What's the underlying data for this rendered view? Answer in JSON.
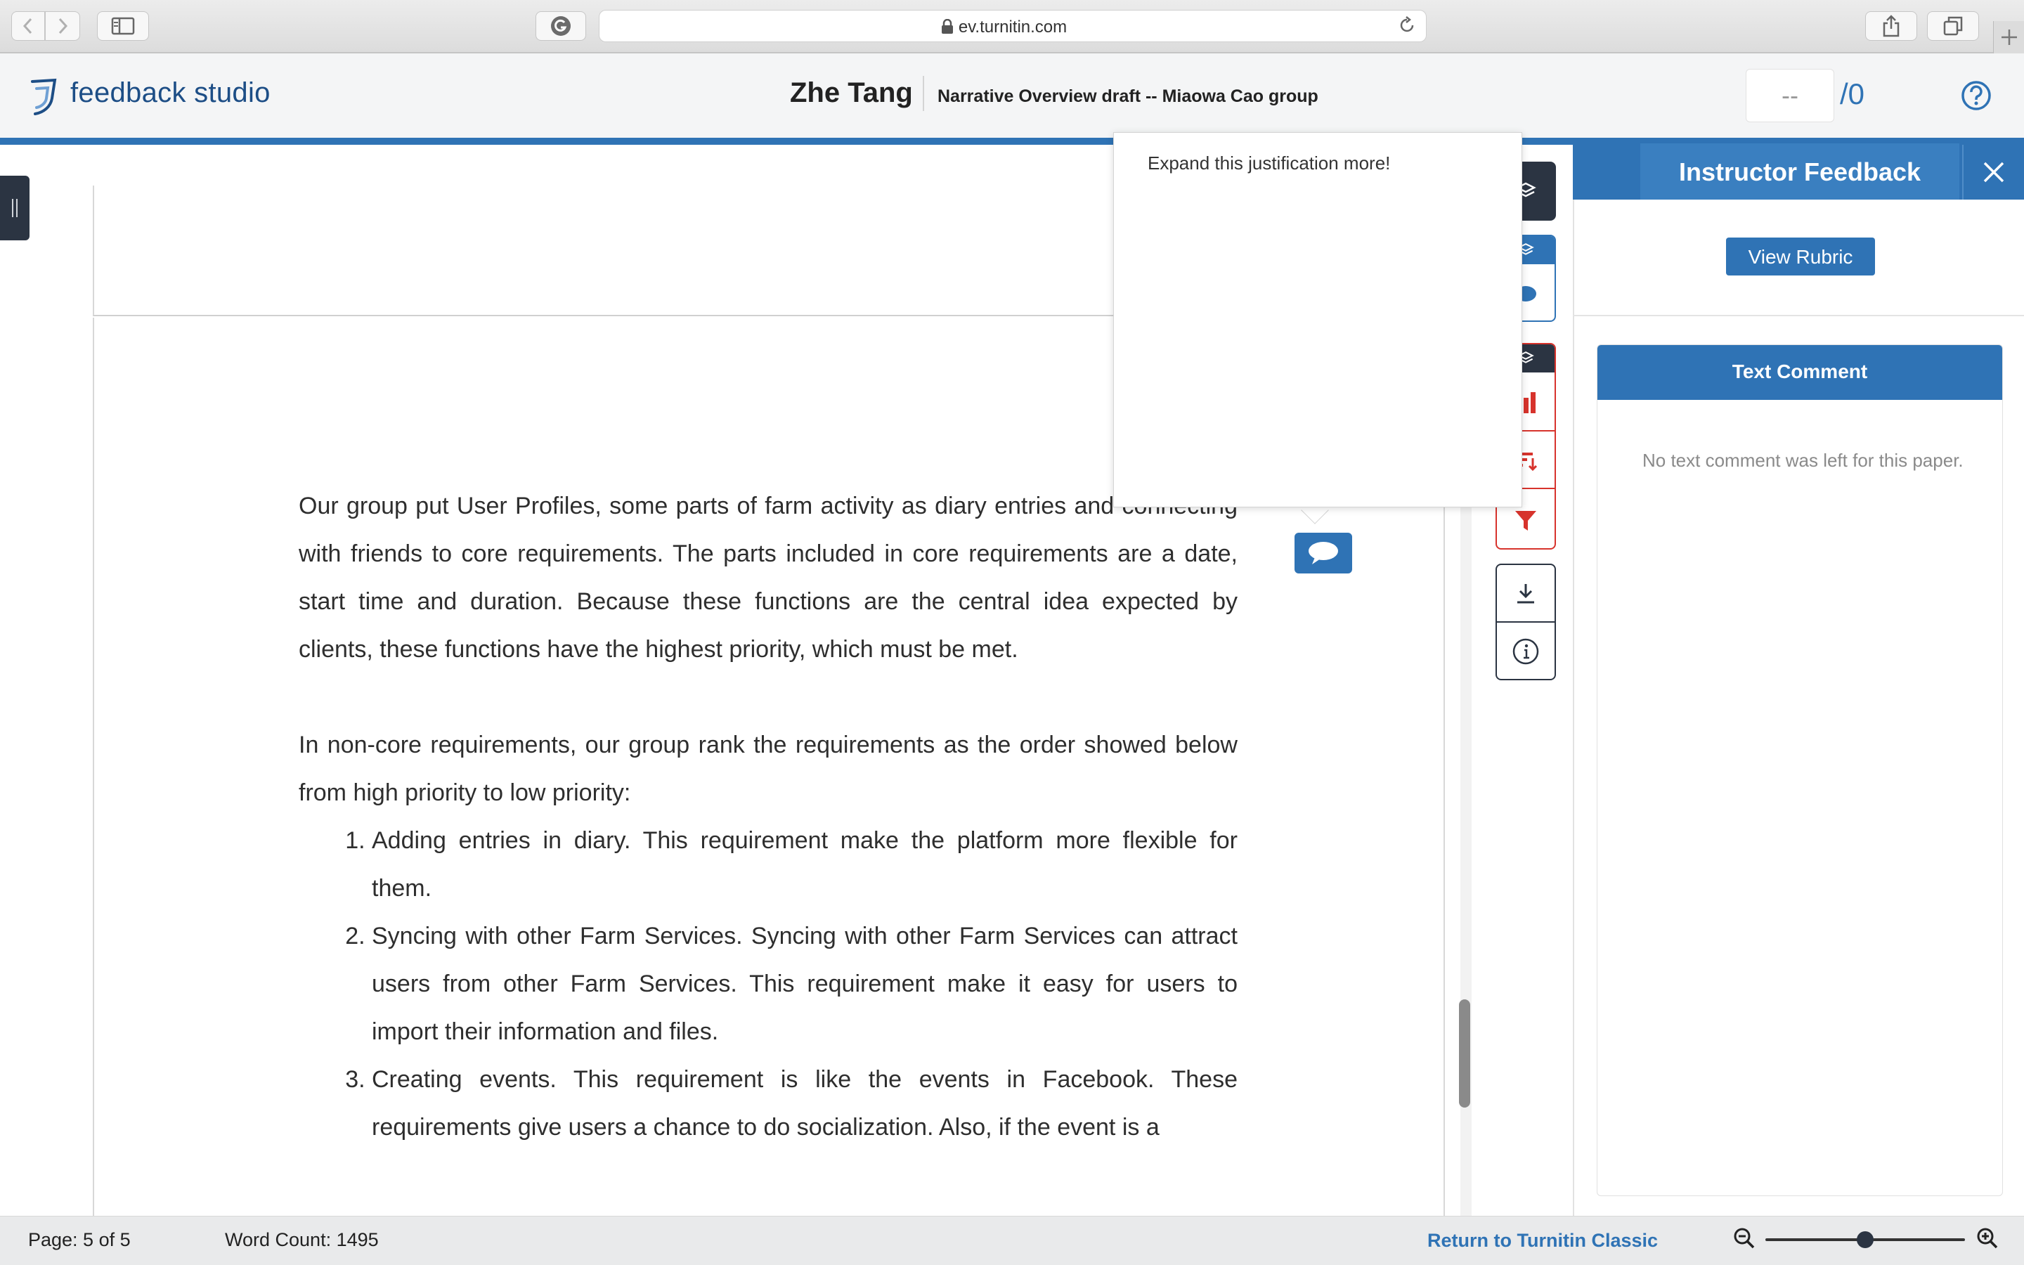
{
  "browser": {
    "url": "ev.turnitin.com"
  },
  "header": {
    "logo_text": "feedback studio",
    "student_name": "Zhe Tang",
    "assignment_title": "Narrative Overview draft -- Miaowa Cao group",
    "grade_value": "--",
    "grade_max": "/0"
  },
  "popup": {
    "comment": "Expand this justification more!"
  },
  "document": {
    "paragraph_1": "Our group put User Profiles, some parts of farm activity as diary entries and connecting with friends to core requirements. The parts included in core requirements are a date, start time and duration. Because these functions are the central idea expected by clients, these functions have the highest priority, which must be met.",
    "paragraph_2": "In non-core requirements, our group rank the requirements as the order showed below from high priority to low priority:",
    "list": [
      "Adding entries in diary. This requirement make the platform more flexible for them.",
      "Syncing with other Farm Services. Syncing with other Farm Services can attract users from other Farm Services. This requirement make it easy for users to import their information and files.",
      "Creating events. This requirement is like the events in Facebook. These requirements give users a chance to do socialization. Also, if the event is a"
    ]
  },
  "panel": {
    "title": "Instructor Feedback",
    "view_rubric_label": "View Rubric",
    "text_comment_header": "Text Comment",
    "text_comment_body": "No text comment was left for this paper."
  },
  "status_bar": {
    "page": "Page: 5 of 5",
    "word_count": "Word Count: 1495",
    "return_link": "Return to Turnitin Classic",
    "zoom_level": 0.5
  },
  "colors": {
    "brand_blue": "#2f73b5",
    "dark_navy": "#2b3442",
    "similarity_red": "#d7332c"
  }
}
